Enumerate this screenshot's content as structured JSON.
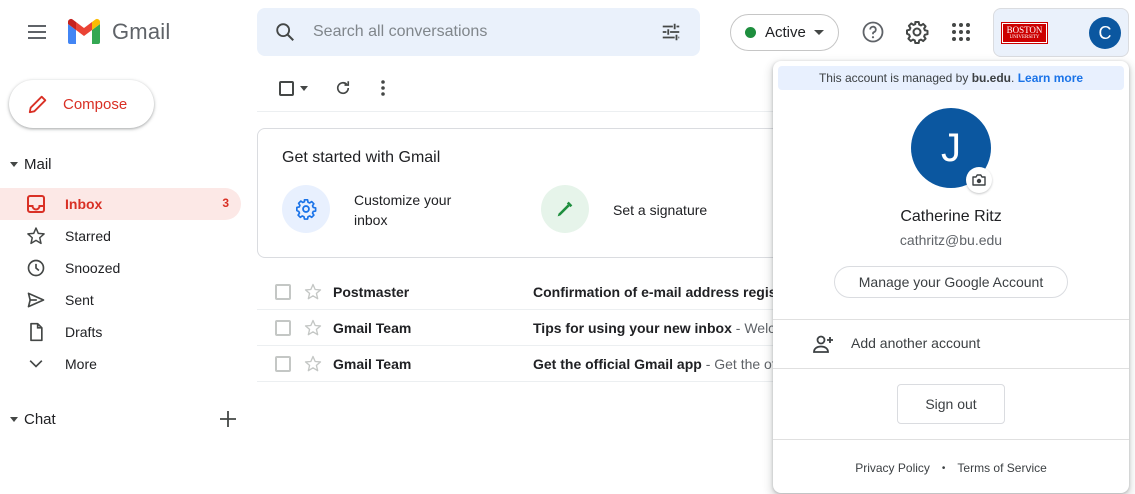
{
  "header": {
    "app_name": "Gmail",
    "search_placeholder": "Search all conversations",
    "status_label": "Active",
    "account_initial": "C",
    "org_logo_text": "BOSTON UNIVERSITY"
  },
  "sidebar": {
    "compose_label": "Compose",
    "mail_section": "Mail",
    "items": [
      {
        "label": "Inbox",
        "count": "3",
        "icon": "inbox-icon"
      },
      {
        "label": "Starred",
        "count": "",
        "icon": "star-icon"
      },
      {
        "label": "Snoozed",
        "count": "",
        "icon": "clock-icon"
      },
      {
        "label": "Sent",
        "count": "",
        "icon": "send-icon"
      },
      {
        "label": "Drafts",
        "count": "",
        "icon": "draft-icon"
      },
      {
        "label": "More",
        "count": "",
        "icon": "chevron-down-icon"
      }
    ],
    "chat_section": "Chat"
  },
  "main": {
    "get_started": {
      "title": "Get started with Gmail",
      "items": [
        {
          "label": "Customize your inbox",
          "icon": "gear-icon"
        },
        {
          "label": "Set a signature",
          "icon": "pen-icon"
        }
      ]
    },
    "emails": [
      {
        "sender": "Postmaster",
        "subject": "Confirmation of e-mail address regist",
        "snippet": ""
      },
      {
        "sender": "Gmail Team",
        "subject": "Tips for using your new inbox",
        "snippet": " - Welco"
      },
      {
        "sender": "Gmail Team",
        "subject": "Get the official Gmail app",
        "snippet": " - Get the of"
      }
    ]
  },
  "account_popup": {
    "managed_prefix": "This account is managed by ",
    "managed_domain": "bu.edu",
    "managed_suffix": ". ",
    "learn_more": "Learn more",
    "avatar_initial": "J",
    "name": "Catherine Ritz",
    "email": "cathritz@bu.edu",
    "manage_button": "Manage your Google Account",
    "add_account": "Add another account",
    "sign_out": "Sign out",
    "privacy_policy": "Privacy Policy",
    "separator": "•",
    "terms": "Terms of Service"
  },
  "colors": {
    "brand_red": "#d93025",
    "avatar_blue": "#0b57a0",
    "status_green": "#1e8e3e",
    "link_blue": "#1a73e8",
    "search_bg": "#eaf1fb"
  }
}
